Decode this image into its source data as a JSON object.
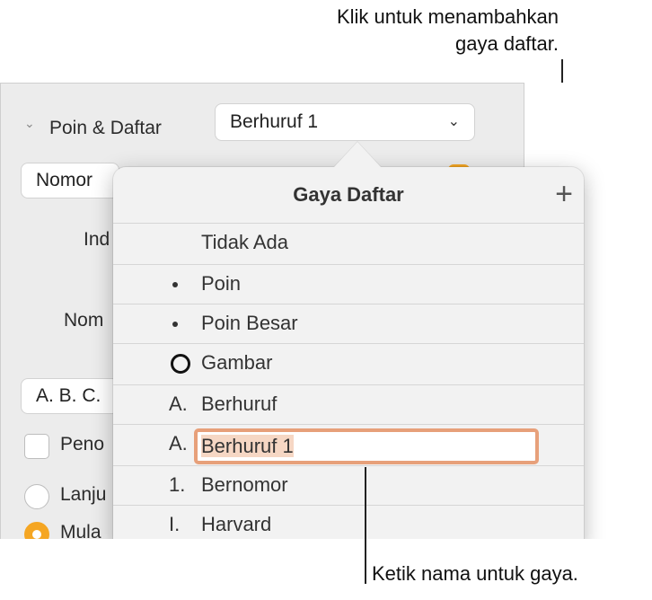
{
  "callouts": {
    "top_line1": "Klik untuk menambahkan",
    "top_line2": "gaya daftar.",
    "bottom": "Ketik nama untuk gaya."
  },
  "inspector": {
    "section_title": "Poin & Daftar",
    "style_value": "Berhuruf 1",
    "numbering_value": "Nomor",
    "label_indent": "Ind",
    "label_number": "Nom",
    "format_value": "A. B. C.",
    "checkbox_label": "Peno",
    "radio_continue": "Lanju",
    "radio_start": "Mula"
  },
  "popover": {
    "title": "Gaya Daftar",
    "add_icon": "+",
    "items": [
      {
        "marker": "",
        "name": "Tidak Ada"
      },
      {
        "marker": "bullet",
        "name": "Poin"
      },
      {
        "marker": "bullet",
        "name": "Poin Besar"
      },
      {
        "marker": "ring",
        "name": "Gambar"
      },
      {
        "marker": "A.",
        "name": "Berhuruf"
      },
      {
        "marker": "A.",
        "name": "Berhuruf 1"
      },
      {
        "marker": "1.",
        "name": "Bernomor"
      },
      {
        "marker": "I.",
        "name": "Harvard"
      }
    ]
  },
  "colors": {
    "accent": "#f5a623",
    "edit_border": "#e7a07a"
  }
}
